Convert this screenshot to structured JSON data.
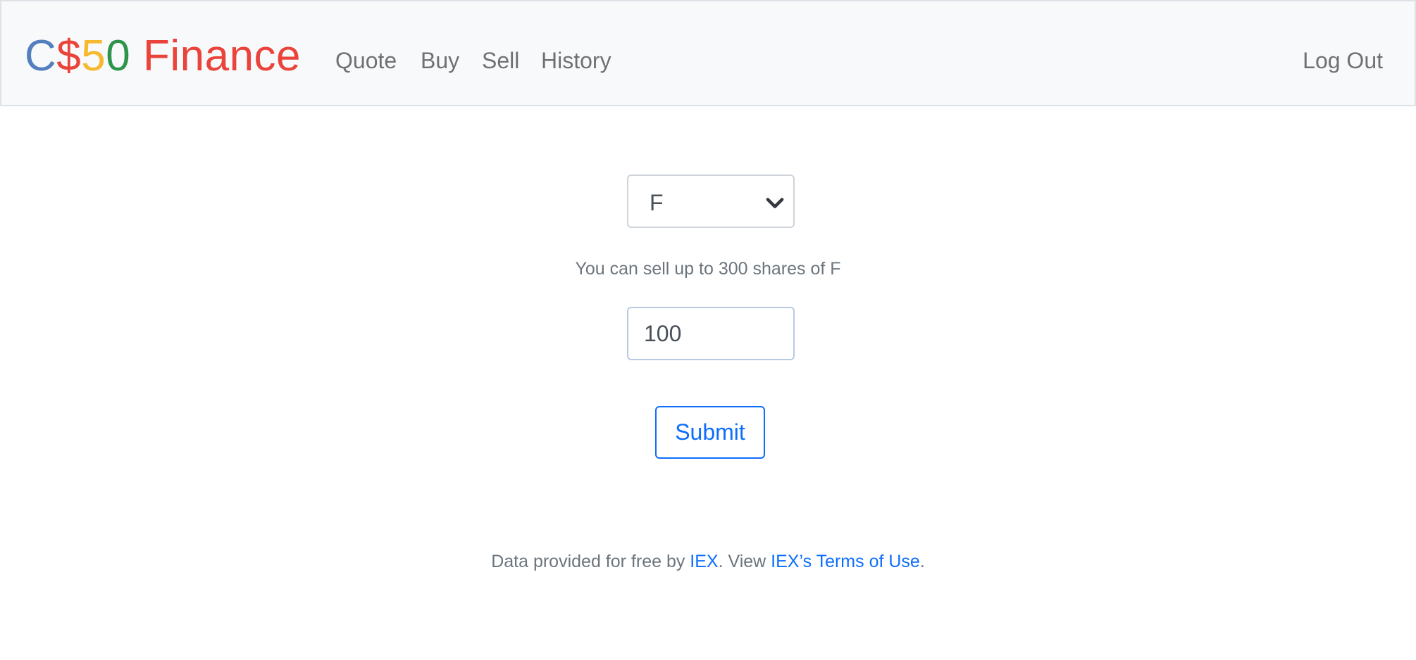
{
  "navbar": {
    "brand": {
      "part1": "C",
      "part2": "$",
      "part3": "5",
      "part4": "0",
      "part5": " Finance",
      "colors": {
        "blue": "#537fbe",
        "red": "#ea433b",
        "yellow": "#f5b82e",
        "green": "#2e944b"
      }
    },
    "links": {
      "quote": "Quote",
      "buy": "Buy",
      "sell": "Sell",
      "history": "History"
    },
    "logout": "Log Out"
  },
  "form": {
    "symbol_selected": "F",
    "hint": "You can sell up to 300 shares of F",
    "shares_value": "100",
    "submit_label": "Submit",
    "accent_color": "#0d6efd"
  },
  "footer": {
    "text_before": "Data provided for free by ",
    "iex_link": "IEX",
    "text_middle": ". View ",
    "terms_link": "IEX’s Terms of Use",
    "text_after": "."
  }
}
